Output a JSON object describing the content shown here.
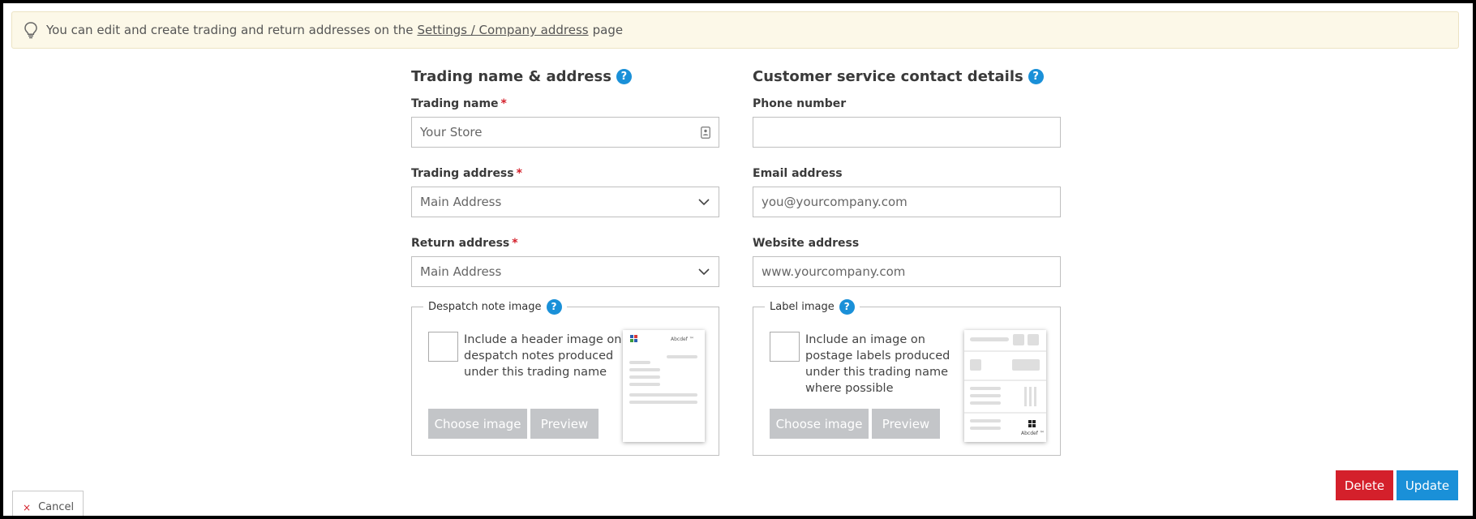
{
  "notice": {
    "text_before": "You can edit and create trading and return addresses on the",
    "link": "Settings / Company address",
    "text_after": "page"
  },
  "trading": {
    "title": "Trading name & address",
    "name_label": "Trading name",
    "name_value": "Your Store",
    "address_label": "Trading address",
    "address_value": "Main Address",
    "return_label": "Return address",
    "return_value": "Main Address"
  },
  "contact": {
    "title": "Customer service contact details",
    "phone_label": "Phone number",
    "phone_value": "",
    "email_label": "Email address",
    "email_placeholder": "you@yourcompany.com",
    "website_label": "Website address",
    "website_placeholder": "www.yourcompany.com"
  },
  "despatch": {
    "legend": "Despatch note image",
    "checkbox_text": "Include a header image on despatch notes produced under this trading name",
    "choose_label": "Choose image",
    "preview_label": "Preview",
    "thumb_brand": "Abcdef ™"
  },
  "label_image": {
    "legend": "Label image",
    "checkbox_text": "Include an image on postage labels produced under this trading name where possible",
    "choose_label": "Choose image",
    "preview_label": "Preview",
    "thumb_brand": "Abcdef ™"
  },
  "help_glyph": "?",
  "required_mark": "*",
  "actions": {
    "cancel_icon": "×",
    "cancel_label": "Cancel",
    "delete_label": "Delete",
    "update_label": "Update"
  },
  "colors": {
    "primary": "#1a90d8",
    "danger": "#d4202b",
    "disabled": "#c3c5c8",
    "notice_bg": "#fcf8e8"
  }
}
